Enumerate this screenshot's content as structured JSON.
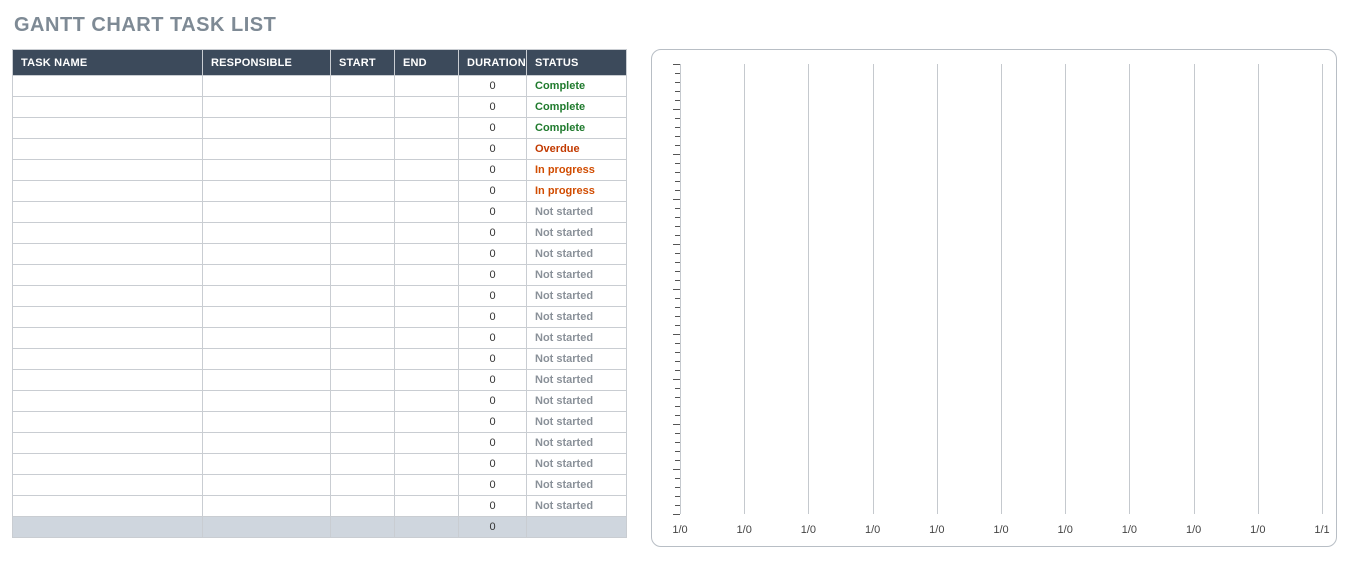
{
  "title": "GANTT CHART TASK LIST",
  "table": {
    "headers": {
      "task": "TASK NAME",
      "responsible": "RESPONSIBLE",
      "start": "START",
      "end": "END",
      "duration": "DURATION",
      "status": "STATUS"
    },
    "rows": [
      {
        "task": "",
        "responsible": "",
        "start": "",
        "end": "",
        "duration": "0",
        "status": "Complete"
      },
      {
        "task": "",
        "responsible": "",
        "start": "",
        "end": "",
        "duration": "0",
        "status": "Complete"
      },
      {
        "task": "",
        "responsible": "",
        "start": "",
        "end": "",
        "duration": "0",
        "status": "Complete"
      },
      {
        "task": "",
        "responsible": "",
        "start": "",
        "end": "",
        "duration": "0",
        "status": "Overdue"
      },
      {
        "task": "",
        "responsible": "",
        "start": "",
        "end": "",
        "duration": "0",
        "status": "In progress"
      },
      {
        "task": "",
        "responsible": "",
        "start": "",
        "end": "",
        "duration": "0",
        "status": "In progress"
      },
      {
        "task": "",
        "responsible": "",
        "start": "",
        "end": "",
        "duration": "0",
        "status": "Not started"
      },
      {
        "task": "",
        "responsible": "",
        "start": "",
        "end": "",
        "duration": "0",
        "status": "Not started"
      },
      {
        "task": "",
        "responsible": "",
        "start": "",
        "end": "",
        "duration": "0",
        "status": "Not started"
      },
      {
        "task": "",
        "responsible": "",
        "start": "",
        "end": "",
        "duration": "0",
        "status": "Not started"
      },
      {
        "task": "",
        "responsible": "",
        "start": "",
        "end": "",
        "duration": "0",
        "status": "Not started"
      },
      {
        "task": "",
        "responsible": "",
        "start": "",
        "end": "",
        "duration": "0",
        "status": "Not started"
      },
      {
        "task": "",
        "responsible": "",
        "start": "",
        "end": "",
        "duration": "0",
        "status": "Not started"
      },
      {
        "task": "",
        "responsible": "",
        "start": "",
        "end": "",
        "duration": "0",
        "status": "Not started"
      },
      {
        "task": "",
        "responsible": "",
        "start": "",
        "end": "",
        "duration": "0",
        "status": "Not started"
      },
      {
        "task": "",
        "responsible": "",
        "start": "",
        "end": "",
        "duration": "0",
        "status": "Not started"
      },
      {
        "task": "",
        "responsible": "",
        "start": "",
        "end": "",
        "duration": "0",
        "status": "Not started"
      },
      {
        "task": "",
        "responsible": "",
        "start": "",
        "end": "",
        "duration": "0",
        "status": "Not started"
      },
      {
        "task": "",
        "responsible": "",
        "start": "",
        "end": "",
        "duration": "0",
        "status": "Not started"
      },
      {
        "task": "",
        "responsible": "",
        "start": "",
        "end": "",
        "duration": "0",
        "status": "Not started"
      },
      {
        "task": "",
        "responsible": "",
        "start": "",
        "end": "",
        "duration": "0",
        "status": "Not started"
      }
    ],
    "footer": {
      "duration": "0"
    }
  },
  "chart_data": {
    "type": "bar",
    "categories": [
      "1/0",
      "1/0",
      "1/0",
      "1/0",
      "1/0",
      "1/0",
      "1/0",
      "1/0",
      "1/0",
      "1/0",
      "1/1"
    ],
    "values": [],
    "title": "",
    "xlabel": "",
    "ylabel": "",
    "ylim": [
      0,
      50
    ],
    "y_minor_ticks": 50,
    "y_major_every": 5
  },
  "status_colors": {
    "Complete": "#1f7a2d",
    "Overdue": "#c23a00",
    "In progress": "#d14c00",
    "Not started": "#8a9199"
  }
}
